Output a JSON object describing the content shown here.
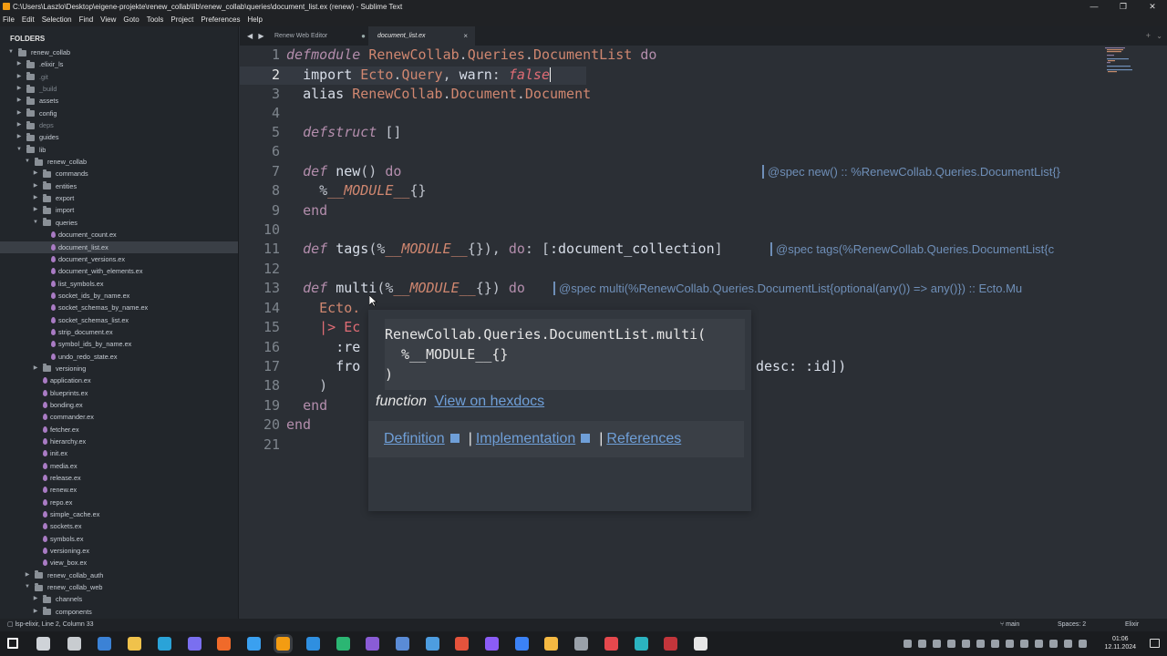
{
  "window": {
    "title": "C:\\Users\\Laszlo\\Desktop\\eigene-projekte\\renew_collab\\lib\\renew_collab\\queries\\document_list.ex (renew) - Sublime Text",
    "controls": [
      "—",
      "❐",
      "✕"
    ]
  },
  "menu": [
    "File",
    "Edit",
    "Selection",
    "Find",
    "View",
    "Goto",
    "Tools",
    "Project",
    "Preferences",
    "Help"
  ],
  "sidebar": {
    "title": "FOLDERS",
    "tree": [
      {
        "label": "renew_collab",
        "type": "folder",
        "open": true,
        "depth": 0
      },
      {
        "label": ".elixir_ls",
        "type": "folder",
        "open": false,
        "depth": 1
      },
      {
        "label": ".git",
        "type": "folder",
        "open": false,
        "depth": 1,
        "dim": true
      },
      {
        "label": "_build",
        "type": "folder",
        "open": false,
        "depth": 1,
        "dim": true
      },
      {
        "label": "assets",
        "type": "folder",
        "open": false,
        "depth": 1
      },
      {
        "label": "config",
        "type": "folder",
        "open": false,
        "depth": 1
      },
      {
        "label": "deps",
        "type": "folder",
        "open": false,
        "depth": 1,
        "dim": true
      },
      {
        "label": "guides",
        "type": "folder",
        "open": false,
        "depth": 1
      },
      {
        "label": "lib",
        "type": "folder",
        "open": true,
        "depth": 1
      },
      {
        "label": "renew_collab",
        "type": "folder",
        "open": true,
        "depth": 2
      },
      {
        "label": "commands",
        "type": "folder",
        "open": false,
        "depth": 3
      },
      {
        "label": "entities",
        "type": "folder",
        "open": false,
        "depth": 3
      },
      {
        "label": "export",
        "type": "folder",
        "open": false,
        "depth": 3
      },
      {
        "label": "import",
        "type": "folder",
        "open": false,
        "depth": 3
      },
      {
        "label": "queries",
        "type": "folder",
        "open": true,
        "depth": 3
      },
      {
        "label": "document_count.ex",
        "type": "file",
        "depth": 4
      },
      {
        "label": "document_list.ex",
        "type": "file",
        "depth": 4,
        "selected": true
      },
      {
        "label": "document_versions.ex",
        "type": "file",
        "depth": 4
      },
      {
        "label": "document_with_elements.ex",
        "type": "file",
        "depth": 4
      },
      {
        "label": "list_symbols.ex",
        "type": "file",
        "depth": 4
      },
      {
        "label": "socket_ids_by_name.ex",
        "type": "file",
        "depth": 4
      },
      {
        "label": "socket_schemas_by_name.ex",
        "type": "file",
        "depth": 4
      },
      {
        "label": "socket_schemas_list.ex",
        "type": "file",
        "depth": 4
      },
      {
        "label": "strip_document.ex",
        "type": "file",
        "depth": 4
      },
      {
        "label": "symbol_ids_by_name.ex",
        "type": "file",
        "depth": 4
      },
      {
        "label": "undo_redo_state.ex",
        "type": "file",
        "depth": 4
      },
      {
        "label": "versioning",
        "type": "folder",
        "open": false,
        "depth": 3
      },
      {
        "label": "application.ex",
        "type": "file",
        "depth": 3
      },
      {
        "label": "blueprints.ex",
        "type": "file",
        "depth": 3
      },
      {
        "label": "bonding.ex",
        "type": "file",
        "depth": 3
      },
      {
        "label": "commander.ex",
        "type": "file",
        "depth": 3
      },
      {
        "label": "fetcher.ex",
        "type": "file",
        "depth": 3
      },
      {
        "label": "hierarchy.ex",
        "type": "file",
        "depth": 3
      },
      {
        "label": "init.ex",
        "type": "file",
        "depth": 3
      },
      {
        "label": "media.ex",
        "type": "file",
        "depth": 3
      },
      {
        "label": "release.ex",
        "type": "file",
        "depth": 3
      },
      {
        "label": "renew.ex",
        "type": "file",
        "depth": 3
      },
      {
        "label": "repo.ex",
        "type": "file",
        "depth": 3
      },
      {
        "label": "simple_cache.ex",
        "type": "file",
        "depth": 3
      },
      {
        "label": "sockets.ex",
        "type": "file",
        "depth": 3
      },
      {
        "label": "symbols.ex",
        "type": "file",
        "depth": 3
      },
      {
        "label": "versioning.ex",
        "type": "file",
        "depth": 3
      },
      {
        "label": "view_box.ex",
        "type": "file",
        "depth": 3
      },
      {
        "label": "renew_collab_auth",
        "type": "folder",
        "open": false,
        "depth": 2
      },
      {
        "label": "renew_collab_web",
        "type": "folder",
        "open": true,
        "depth": 2
      },
      {
        "label": "channels",
        "type": "folder",
        "open": false,
        "depth": 3
      },
      {
        "label": "components",
        "type": "folder",
        "open": false,
        "depth": 3
      }
    ]
  },
  "tabs": {
    "nav": "◀ ▶",
    "items": [
      {
        "label": "Renew Web Editor",
        "active": false,
        "marker": "●"
      },
      {
        "label": "document_list.ex",
        "active": true,
        "marker": "×"
      }
    ],
    "plus": "+",
    "menu": "⌄"
  },
  "editor": {
    "line_numbers": [
      "1",
      "2",
      "3",
      "4",
      "5",
      "6",
      "7",
      "8",
      "9",
      "10",
      "11",
      "12",
      "13",
      "14",
      "15",
      "16",
      "17",
      "18",
      "19",
      "20",
      "21"
    ],
    "current_line": "2",
    "inlays": {
      "spec_new": "@spec new() :: %RenewCollab.Queries.DocumentList{}",
      "spec_tags": "@spec tags(%RenewCollab.Queries.DocumentList{c",
      "spec_multi": "@spec multi(%RenewCollab.Queries.DocumentList{optional(any()) => any()}) :: Ecto.Mu"
    },
    "hidden_fragments": {
      "l14": "Ecto.",
      "l15": "|> Ec",
      "l16": ":re",
      "l17_left": "fro",
      "l17_right": "desc: :id])"
    }
  },
  "popup": {
    "signature": "RenewCollab.Queries.DocumentList.multi(\n  %__MODULE__{}\n)",
    "kind": "function",
    "hexdocs_link": "View on hexdocs",
    "definition": "Definition",
    "implementation": "Implementation",
    "references": "References",
    "separator": "|"
  },
  "status": {
    "left": "lsp-elixir, Line 2, Column 33",
    "branch": "main",
    "spaces": "Spaces: 2",
    "syntax": "Elixir"
  },
  "taskbar": {
    "time": "01:06",
    "date": "12.11.2024",
    "icons": [
      {
        "name": "windows-start-icon",
        "color": "#ffffff"
      },
      {
        "name": "task-view-icon",
        "color": "#cfd3d8"
      },
      {
        "name": "terminal-icon",
        "color": "#c8ccd0"
      },
      {
        "name": "browser-icon",
        "color": "#3b82d6"
      },
      {
        "name": "folder-icon",
        "color": "#f0c24b"
      },
      {
        "name": "edge-icon",
        "color": "#2aa3d8"
      },
      {
        "name": "discord-icon",
        "color": "#7a6ff0"
      },
      {
        "name": "firefox-icon",
        "color": "#f06a2a"
      },
      {
        "name": "chrome-icon",
        "color": "#3aa0f0"
      },
      {
        "name": "sublime-icon",
        "color": "#f39c12"
      },
      {
        "name": "vscode-icon",
        "color": "#2f8fe0"
      },
      {
        "name": "vscode-insiders-icon",
        "color": "#2bb673"
      },
      {
        "name": "visual-studio-icon",
        "color": "#8a5cd6"
      },
      {
        "name": "gear-icon",
        "color": "#5a8bd6"
      },
      {
        "name": "app-icon-blue",
        "color": "#4d9de0"
      },
      {
        "name": "git-icon",
        "color": "#e5533c"
      },
      {
        "name": "obsidian-icon",
        "color": "#8b5cf6"
      },
      {
        "name": "mail-icon",
        "color": "#3b82f6"
      },
      {
        "name": "app-icon-yellow",
        "color": "#f5b942"
      },
      {
        "name": "database-icon",
        "color": "#9aa1a9"
      },
      {
        "name": "app-icon-red",
        "color": "#e5484d"
      },
      {
        "name": "app-icon-teal",
        "color": "#2bb3c0"
      },
      {
        "name": "app-icon-maroon",
        "color": "#c2353b"
      },
      {
        "name": "app-icon-white",
        "color": "#e6e6e6"
      }
    ]
  }
}
